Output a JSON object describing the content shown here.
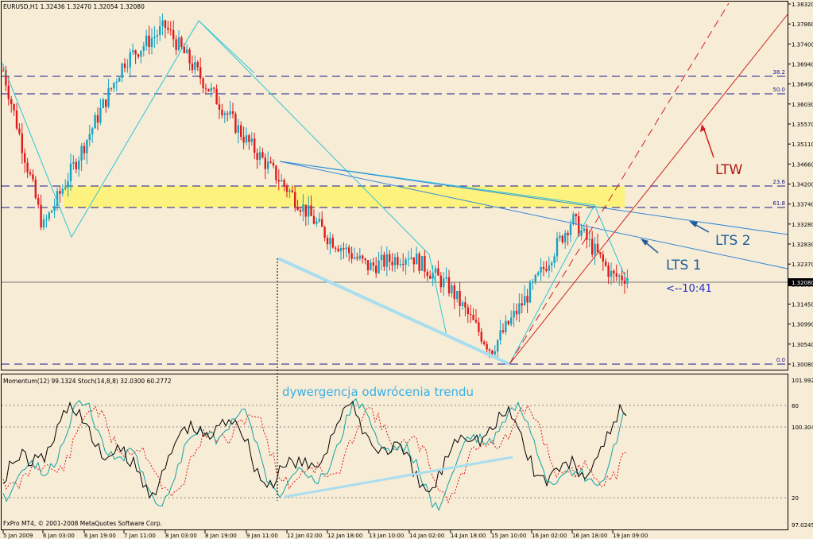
{
  "colors": {
    "background": "#f7ecd6",
    "frame": "#000000",
    "candle_up": "#13a3c4",
    "candle_down": "#e01b1b",
    "fib_line": "#1a1a8c",
    "trend_cyan": "#2bc8d8",
    "lts_blue": "#3388d8",
    "ltw_red": "#d12020",
    "fib_zone": "#fff36e",
    "divergence": "#a8def0",
    "stoch_main": "#13a3a3",
    "stoch_signal": "#e01b1b",
    "momentum": "#000000"
  },
  "header": {
    "main_title": "EURUSD,H1  1.32436 1.32470 1.32054 1.32080",
    "indicator_title": "Momentum(12) 99.1324  Stoch(14,8,8) 32.0300 60.2772",
    "footer": "FxPro MT4, © 2001-2008 MetaQuotes Software Corp."
  },
  "annotations": {
    "ltw": "LTW",
    "lts2": "LTS 2",
    "lts1": "LTS 1",
    "time_marker": "<--10:41",
    "divergence": "dywergencja odwrócenia trendu"
  },
  "chart_data": [
    {
      "type": "candlestick",
      "title": "EURUSD,H1",
      "symbol": "EURUSD",
      "timeframe": "H1",
      "quote": {
        "open": 1.32436,
        "high": 1.3247,
        "low": 1.32054,
        "close": 1.3208
      },
      "current_price_label": "1.32080",
      "ylim": [
        1.3008,
        1.3832
      ],
      "price_axis_labels": [
        "1.38320",
        "1.37860",
        "1.37400",
        "1.36940",
        "1.36490",
        "1.36030",
        "1.35570",
        "1.35110",
        "1.34660",
        "1.34200",
        "1.33740",
        "1.33280",
        "1.32830",
        "1.32370",
        "1.31910",
        "1.31450",
        "1.30990",
        "1.30540",
        "1.30080"
      ],
      "time_axis_labels": [
        "5 Jan 2009",
        "6 Jan 03:00",
        "6 Jan 19:00",
        "7 Jan 11:00",
        "8 Jan 03:00",
        "8 Jan 19:00",
        "9 Jan 11:00",
        "12 Jan 02:00",
        "12 Jan 18:00",
        "13 Jan 10:00",
        "14 Jan 02:00",
        "14 Jan 18:00",
        "15 Jan 10:00",
        "16 Jan 02:00",
        "16 Jan 18:00",
        "19 Jan 09:00"
      ],
      "fibonacci_levels": [
        {
          "label": "38.2",
          "price": 1.367
        },
        {
          "label": "50.0",
          "price": 1.363
        },
        {
          "label": "23.6",
          "price": 1.3425
        },
        {
          "label": "61.8",
          "price": 1.3375
        },
        {
          "label": "0.0",
          "price": 1.3023
        }
      ],
      "highlight_zone": {
        "from": 1.3375,
        "to": 1.3425
      },
      "approx_close_path": [
        {
          "time": "5 Jan 2009",
          "price": 1.368
        },
        {
          "time": "6 Jan 03:00",
          "price": 1.332
        },
        {
          "time": "6 Jan 19:00",
          "price": 1.351
        },
        {
          "time": "7 Jan 11:00",
          "price": 1.37
        },
        {
          "time": "8 Jan 03:00",
          "price": 1.378
        },
        {
          "time": "8 Jan 19:00",
          "price": 1.365
        },
        {
          "time": "9 Jan 11:00",
          "price": 1.352
        },
        {
          "time": "12 Jan 02:00",
          "price": 1.341
        },
        {
          "time": "12 Jan 18:00",
          "price": 1.33
        },
        {
          "time": "13 Jan 10:00",
          "price": 1.323
        },
        {
          "time": "14 Jan 02:00",
          "price": 1.326
        },
        {
          "time": "14 Jan 18:00",
          "price": 1.318
        },
        {
          "time": "15 Jan 10:00",
          "price": 1.304
        },
        {
          "time": "16 Jan 02:00",
          "price": 1.318
        },
        {
          "time": "16 Jan 18:00",
          "price": 1.334
        },
        {
          "time": "19 Jan 09:00",
          "price": 1.3208
        }
      ]
    },
    {
      "type": "line",
      "title": "Momentum(12) 99.1324  Stoch(14,8,8) 32.0300 60.2772",
      "series": [
        {
          "name": "Momentum(12)",
          "last": 99.1324
        },
        {
          "name": "Stoch(14,8,8)",
          "main": 32.03,
          "signal": 60.2772
        }
      ],
      "axis_labels": [
        "101.9923",
        "80",
        "100.3046",
        "20",
        "97.0245"
      ],
      "ylim": [
        97.0245,
        101.9923
      ],
      "level_lines": [
        80,
        20
      ]
    }
  ]
}
